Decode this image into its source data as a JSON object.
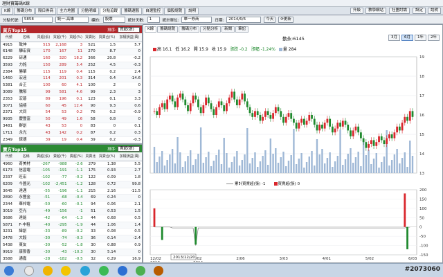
{
  "window": {
    "title": "理財寶籌碼K線"
  },
  "tabs": [
    "K線",
    "籌碼分布",
    "隔日券商",
    "主力地圖",
    "分點明細",
    "分點追蹤",
    "籌碼選股",
    "自選監控",
    "個股總覽",
    "說明"
  ],
  "active_tab": 5,
  "right_buttons": [
    "升級",
    "教學網站",
    "社團討論",
    "設定",
    "說明"
  ],
  "toolbar": {
    "code_label": "分點代號:",
    "code_value": "5858",
    "branch_value": "統一-高雄",
    "type_label": "標的:",
    "type_value": "股票",
    "days_label": "統計天數:",
    "days_value": "1",
    "unit_label": "統計單位:",
    "unit_value": "單一券商",
    "date_label": "日期:",
    "date_value": "2014/6/6",
    "today_label": "今天",
    "refresh_label": "更新"
  },
  "buy_panel": {
    "title": "買方Top15",
    "sort_label": "排序:",
    "sort_value": "買超(張)",
    "headers": [
      "代號",
      "名稱",
      "買超(張)",
      "買超(千)",
      "買超(%)",
      "買賣比",
      "買賣合(%)",
      "加權損益(萬)"
    ],
    "rows": [
      [
        "4915",
        "致伸",
        "515",
        "2,168",
        "3",
        "521",
        "1.5",
        "5.7"
      ],
      [
        "6148",
        "驊宏資",
        "170",
        "167",
        "11",
        "270",
        "8.7",
        "0"
      ],
      [
        "6229",
        "研通",
        "160",
        "320",
        "18.2",
        "366",
        "20.8",
        "-0.2"
      ],
      [
        "3593",
        "力銘",
        "150",
        "289",
        "5.4",
        "252",
        "4.5",
        "-0.3"
      ],
      [
        "2384",
        "勝華",
        "115",
        "119",
        "0.4",
        "115",
        "0.2",
        "2.4"
      ],
      [
        "1460",
        "宏遠",
        "114",
        "201",
        "0.3",
        "314",
        "0.4",
        "-14.6"
      ],
      [
        "5381",
        "合正",
        "100",
        "60",
        "4.1",
        "100",
        "2",
        "0"
      ],
      [
        "3089",
        "騰郁",
        "99",
        "581",
        "4.6",
        "99",
        "2.3",
        "3"
      ],
      [
        "2353",
        "宏碁",
        "89",
        "196",
        "0.1",
        "123",
        "0.1",
        "3.3"
      ],
      [
        "3071",
        "協禧",
        "60",
        "45",
        "12.4",
        "90",
        "9.3",
        "0.6"
      ],
      [
        "2371",
        "大同",
        "54",
        "53",
        "0.2",
        "76",
        "0.2",
        "-0.9"
      ],
      [
        "9935",
        "慶豐富",
        "50",
        "49",
        "1.6",
        "58",
        "0.8",
        "0"
      ],
      [
        "3481",
        "群創",
        "43",
        "53",
        "0",
        "83",
        "0",
        "0.1"
      ],
      [
        "1711",
        "永光",
        "43",
        "142",
        "0.2",
        "87",
        "0.2",
        "0.3"
      ],
      [
        "2349",
        "錸德",
        "39",
        "19",
        "0.4",
        "39",
        "0.2",
        "-0.3"
      ]
    ]
  },
  "sell_panel": {
    "title": "賣方Top15",
    "sort_label": "排序:",
    "sort_value": "賣超(張)",
    "headers": [
      "代號",
      "名稱",
      "賣超(張)",
      "賣超(千)",
      "賣超(%)",
      "買賣比",
      "買賣合(%)",
      "加權損益(萬)"
    ],
    "rows": [
      [
        "4960",
        "奇美材",
        "-267",
        "-988",
        "-2.6",
        "279",
        "1.38",
        "5.5"
      ],
      [
        "6173",
        "信昌電",
        "-105",
        "-191",
        "-1.1",
        "175",
        "0.93",
        "2.7"
      ],
      [
        "2337",
        "旺宏",
        "-102",
        "-77",
        "-0.2",
        "122",
        "0.09",
        "1.8"
      ],
      [
        "6209",
        "今國光",
        "-102",
        "-2,451",
        "-1.2",
        "128",
        "0.72",
        "99.8"
      ],
      [
        "3645",
        "達邁",
        "-55",
        "-196",
        "-1.1",
        "215",
        "2.16",
        "-11.5"
      ],
      [
        "2890",
        "永豐金",
        "-51",
        "-68",
        "-0.4",
        "69",
        "0.24",
        "0"
      ],
      [
        "2344",
        "華邦電",
        "-50",
        "-60",
        "-0.1",
        "94",
        "0.06",
        "2.1"
      ],
      [
        "3019",
        "亞光",
        "-49",
        "-156",
        "-1",
        "51",
        "0.53",
        "1.5"
      ],
      [
        "3686",
        "達能",
        "-42",
        "-64",
        "-1.3",
        "44",
        "0.68",
        "0.5"
      ],
      [
        "5871",
        "F-中租",
        "-40",
        "-295",
        "-1.9",
        "44",
        "1.06",
        "1.4"
      ],
      [
        "3231",
        "緯創",
        "-33",
        "-89",
        "-0.2",
        "33",
        "0.08",
        "0.5"
      ],
      [
        "2478",
        "大毅",
        "-30",
        "-74",
        "-0.3",
        "36",
        "0.14",
        "-2.4"
      ],
      [
        "5438",
        "東友",
        "-30",
        "-52",
        "-1.8",
        "30",
        "0.88",
        "0.9"
      ],
      [
        "9919",
        "康那香",
        "-30",
        "-43",
        "-10.3",
        "30",
        "5.14",
        "0"
      ],
      [
        "3588",
        "通嘉",
        "-28",
        "-182",
        "-0.5",
        "32",
        "0.29",
        "16.9"
      ]
    ]
  },
  "chart_panel": {
    "subtabs": [
      "K線",
      "籌碼總覽",
      "籌碼分布",
      "分點分析",
      "新聞",
      "筆記"
    ],
    "title": "勤永:6145",
    "periods": [
      "3月",
      "6月",
      "1年",
      "2年"
    ],
    "active_period": 1,
    "stats": {
      "high": "高 16.1",
      "low": "低 16.2",
      "open": "開 15.9",
      "close": "收 15.9",
      "change": "漲跌 -0.2",
      "pct": "漲幅 -1.24%",
      "vol": "量 284"
    },
    "legend_cum": "累計買賣超(張) -1",
    "legend_daily": "買賣超(張) 0",
    "cursor_date": "2013/12/20",
    "colors": {
      "up": "#d9262c",
      "down": "#1f8a2e",
      "volume": "#9fb8d6",
      "cum_line": "#8a8a8a"
    }
  },
  "chart_data": {
    "type": "candlestick",
    "x_ticks": [
      "12/02 2013",
      "1/02 2014",
      "2/06",
      "3/03",
      "4/01",
      "5/02",
      "6/03"
    ],
    "price_axis": {
      "ylim": [
        13,
        19
      ],
      "ticks": [
        13,
        14,
        15,
        16,
        17,
        18,
        19
      ]
    },
    "lower_axis": {
      "ylim": [
        -150,
        200
      ],
      "ticks": [
        200,
        150,
        100,
        50,
        0,
        -50,
        -100,
        -150
      ]
    },
    "price_series": [
      16.2,
      16.0,
      16.4,
      16.6,
      16.3,
      16.8,
      17.0,
      16.7,
      16.4,
      16.9,
      17.1,
      16.8,
      16.5,
      16.2,
      16.6,
      17.0,
      16.8,
      16.4,
      16.1,
      16.5,
      16.9,
      16.6,
      16.3,
      16.0,
      16.4,
      16.7,
      16.5,
      16.2,
      16.6,
      16.9,
      17.2,
      16.8,
      16.5,
      16.8,
      17.1,
      16.7,
      16.4,
      16.1,
      15.9,
      16.2,
      16.0,
      15.7,
      15.9,
      16.2,
      16.0,
      15.8,
      16.1,
      16.4,
      16.2,
      15.9,
      15.6,
      15.9,
      16.1,
      15.8,
      15.6,
      15.3,
      15.6,
      15.8,
      15.5,
      15.7,
      16.0,
      15.8,
      15.5,
      15.2,
      15.5,
      15.3,
      15.6,
      15.8,
      15.4,
      15.1,
      15.3,
      15.6,
      15.4,
      15.7,
      15.5,
      15.2,
      14.9,
      15.2,
      15.4,
      15.1,
      14.8,
      14.6,
      14.3,
      14.5,
      14.7,
      14.4,
      14.6,
      14.9,
      14.7,
      14.5,
      14.8,
      15.0,
      14.8,
      15.1,
      15.4,
      15.2,
      15.6,
      15.9,
      15.7,
      16.2,
      15.9
    ],
    "cum_series": [
      0,
      0,
      0,
      0,
      0,
      0,
      0,
      -5,
      -5,
      -5,
      -5,
      -5,
      -5,
      -5,
      -5,
      -5,
      -100,
      -5,
      -5,
      -5,
      -5,
      -5,
      -5,
      -5,
      -5,
      -5,
      -5,
      -5,
      -5,
      -5,
      -5,
      -5,
      -5,
      -5,
      -5,
      -5,
      -5,
      -5,
      -5,
      -5,
      -5,
      -5,
      -5,
      -5,
      -5,
      -5,
      -5,
      -5,
      -5,
      -5,
      -5,
      -5,
      -5,
      -5,
      -5,
      -5,
      -5,
      -5,
      -5,
      -5,
      -5,
      -5,
      -5,
      -5,
      -5,
      -5,
      -5,
      -5,
      -5,
      -5,
      -5,
      -5,
      -5,
      -5,
      -5,
      -5,
      -5,
      -5,
      -5,
      -5,
      -5,
      -5,
      -5,
      -5,
      -5,
      -5,
      -5,
      -5,
      -5,
      -5,
      -5,
      -5,
      -5,
      -5,
      -5,
      -5,
      -5,
      -5,
      -1,
      -1
    ],
    "daily_bars": [
      {
        "i": 0,
        "v": 100
      },
      {
        "i": 3,
        "v": -70
      },
      {
        "i": 16,
        "v": -95
      },
      {
        "i": 97,
        "v": 180
      },
      {
        "i": 98,
        "v": -120
      }
    ]
  }
}
